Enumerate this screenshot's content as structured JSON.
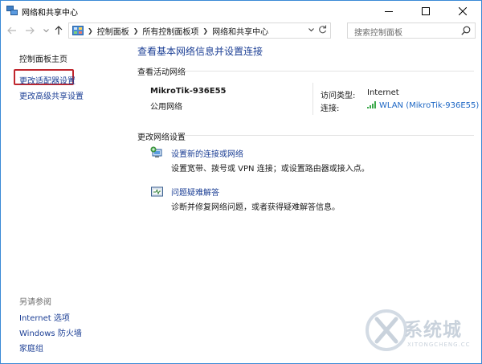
{
  "window": {
    "title": "网络和共享中心"
  },
  "address_bar": {
    "crumbs": [
      "控制面板",
      "所有控制面板项",
      "网络和共享中心"
    ],
    "search_placeholder": "搜索控制面板"
  },
  "left_pane": {
    "home": "控制面板主页",
    "adapter_settings": "更改适配器设置",
    "advanced_sharing": "更改高级共享设置",
    "see_also": "另请参阅",
    "internet_options": "Internet 选项",
    "firewall": "Windows 防火墙",
    "homegroup": "家庭组"
  },
  "main": {
    "title": "查看基本网络信息并设置连接",
    "active_networks_heading": "查看活动网络",
    "network": {
      "name": "MikroTik-936E55",
      "type": "公用网络",
      "access_label": "访问类型:",
      "access_value": "Internet",
      "connection_label": "连接:",
      "connection_value": "WLAN (MikroTik-936E55)"
    },
    "change_settings_heading": "更改网络设置",
    "tasks": [
      {
        "link": "设置新的连接或网络",
        "desc": "设置宽带、拨号或 VPN 连接；或设置路由器或接入点。"
      },
      {
        "link": "问题疑难解答",
        "desc": "诊断并修复网络问题，或者获得疑难解答信息。"
      }
    ]
  },
  "colors": {
    "link": "#1c3f95",
    "highlight_box": "#c0262d",
    "window_border": "#3a8ad6"
  },
  "watermark": {
    "text": "系统城",
    "sub": "XITONGCHENG.CC"
  }
}
